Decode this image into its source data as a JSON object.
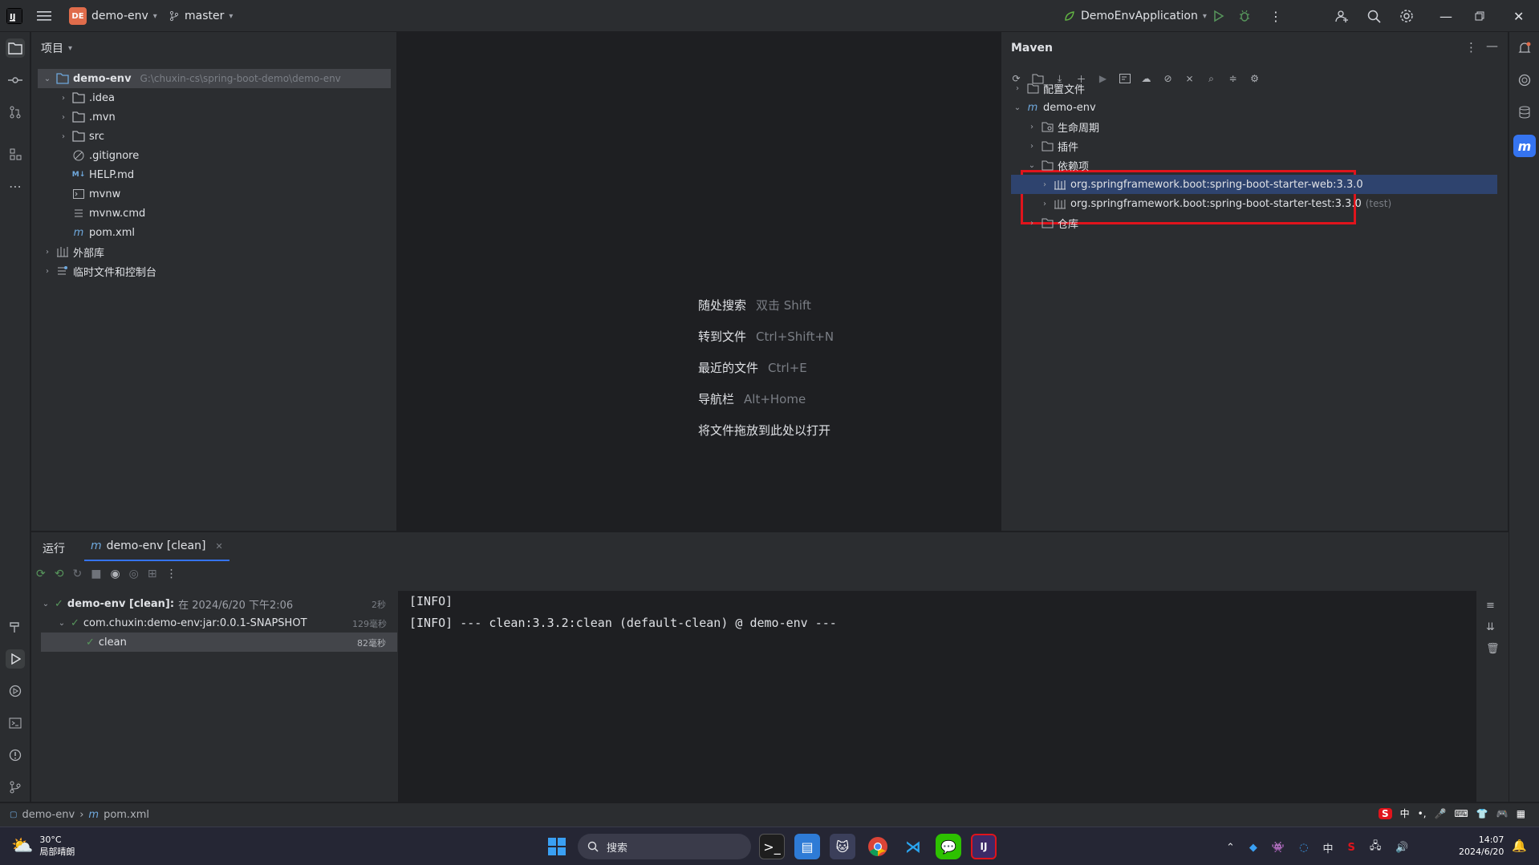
{
  "titlebar": {
    "project_badge": "DE",
    "project_name": "demo-env",
    "branch": "master",
    "run_config": "DemoEnvApplication"
  },
  "project_panel": {
    "title": "项目",
    "root": {
      "name": "demo-env",
      "path": "G:\\chuxin-cs\\spring-boot-demo\\demo-env"
    },
    "items": [
      {
        "label": ".idea"
      },
      {
        "label": ".mvn"
      },
      {
        "label": "src"
      },
      {
        "label": ".gitignore"
      },
      {
        "label": "HELP.md",
        "badge": "M↓"
      },
      {
        "label": "mvnw"
      },
      {
        "label": "mvnw.cmd"
      },
      {
        "label": "pom.xml"
      },
      {
        "label": "外部库"
      },
      {
        "label": "临时文件和控制台"
      }
    ]
  },
  "editor": {
    "hints": [
      {
        "label": "随处搜索",
        "key": "双击 Shift"
      },
      {
        "label": "转到文件",
        "key": "Ctrl+Shift+N"
      },
      {
        "label": "最近的文件",
        "key": "Ctrl+E"
      },
      {
        "label": "导航栏",
        "key": "Alt+Home"
      },
      {
        "label": "将文件拖放到此处以打开",
        "key": ""
      }
    ]
  },
  "maven": {
    "title": "Maven",
    "tree": [
      {
        "label": "配置文件"
      },
      {
        "label": "demo-env"
      },
      {
        "label": "生命周期"
      },
      {
        "label": "插件"
      },
      {
        "label": "依赖项"
      },
      {
        "label": "org.springframework.boot:spring-boot-starter-web:3.3.0",
        "suffix": ""
      },
      {
        "label": "org.springframework.boot:spring-boot-starter-test:3.3.0",
        "suffix": "(test)"
      },
      {
        "label": "仓库"
      }
    ]
  },
  "run_panel": {
    "tab_run": "运行",
    "tab_config": "demo-env [clean]",
    "tree": [
      {
        "label": "demo-env [clean]:",
        "detail": "在 2024/6/20 下午2:06",
        "time": "2秒"
      },
      {
        "label": "com.chuxin:demo-env:jar:0.0.1-SNAPSHOT",
        "detail": "",
        "time": "129毫秒"
      },
      {
        "label": "clean",
        "detail": "",
        "time": "82毫秒"
      }
    ],
    "console": [
      "[INFO]",
      "[INFO] --- clean:3.3.2:clean (default-clean) @ demo-env ---"
    ]
  },
  "statusbar": {
    "crumb1": "demo-env",
    "crumb2": "pom.xml"
  },
  "taskbar": {
    "weather_temp": "30°C",
    "weather_desc": "局部晴朗",
    "search_placeholder": "搜索",
    "ime": "中",
    "time": "14:07",
    "date": "2024/6/20"
  },
  "colors": {
    "highlight_box": "#e0141c",
    "selection": "#2e436e",
    "accent": "#3574f0"
  }
}
